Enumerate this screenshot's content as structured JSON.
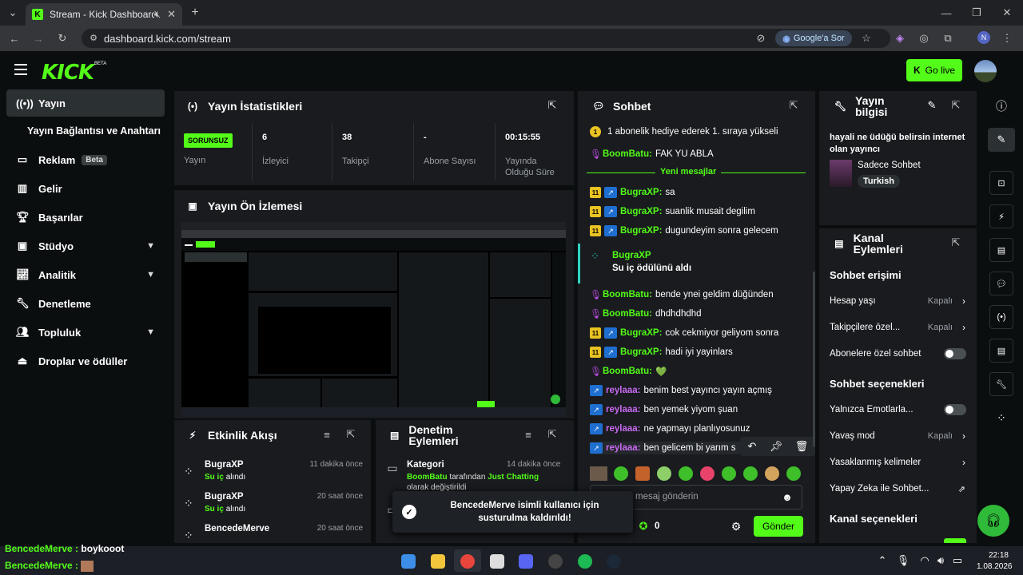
{
  "browser": {
    "tab_title": "Stream - Kick Dashboard",
    "new_tab": "+",
    "url": "dashboard.kick.com/stream",
    "google_sor": "Google'a Sor",
    "profile_initial": "N"
  },
  "header": {
    "logo": "KICK",
    "logo_beta": "BETA",
    "go_live": "Go live"
  },
  "sidebar": {
    "items": [
      {
        "label": "Yayın",
        "icon": "broadcast-icon"
      },
      {
        "label": "Yayın Bağlantısı ve Anahtarı"
      },
      {
        "label": "Reklam",
        "badge": "Beta"
      },
      {
        "label": "Gelir"
      },
      {
        "label": "Başarılar"
      },
      {
        "label": "Stüdyo"
      },
      {
        "label": "Analitik"
      },
      {
        "label": "Denetleme"
      },
      {
        "label": "Topluluk"
      },
      {
        "label": "Droplar ve ödüller"
      }
    ]
  },
  "stats": {
    "title": "Yayın İstatistikleri",
    "status": "SORUNSUZ",
    "status_label": "Yayın",
    "viewers": "6",
    "viewers_label": "İzleyici",
    "followers": "38",
    "followers_label": "Takipçi",
    "subs": "-",
    "subs_label": "Abone Sayısı",
    "uptime": "00:15:55",
    "uptime_label": "Yayında Olduğu Süre"
  },
  "preview": {
    "title": "Yayın Ön İzlemesi"
  },
  "events": {
    "title": "Etkinlik Akışı",
    "items": [
      {
        "name": "BugraXP",
        "action": "Su iç",
        "suffix": "alındı",
        "time": "11 dakika önce"
      },
      {
        "name": "BugraXP",
        "action": "Su iç",
        "suffix": "alındı",
        "time": "20 saat önce"
      },
      {
        "name": "BencedeMerve",
        "action": "",
        "suffix": "",
        "time": "20 saat önce"
      }
    ]
  },
  "moderation": {
    "title": "Denetim Eylemleri",
    "item_title": "Kategori",
    "item_time": "14 dakika önce",
    "item_user": "BoomBatu",
    "item_mid": "tarafından",
    "item_cat": "Just Chatting",
    "item_end": "olarak değiştirildi"
  },
  "toast": {
    "text": "BencedeMerve isimli kullanıcı için susturulma kaldırıldı!"
  },
  "chat": {
    "title": "Sohbet",
    "pinned": "1 abonelik hediye ederek 1. sıraya yükseli",
    "new_messages": "Yeni mesajlar",
    "messages": [
      {
        "user": "BoomBatu:",
        "text": "FAK YU ABLA"
      },
      {
        "user": "BugraXP:",
        "text": "sa"
      },
      {
        "user": "BugraXP:",
        "text": "suanlik musait degilim"
      },
      {
        "user": "BugraXP:",
        "text": "dugundeyim sonra gelecem"
      },
      {
        "user": "BugraXP",
        "text": "Su iç ödülünü aldı"
      },
      {
        "user": "BoomBatu:",
        "text": "bende ynei geldim düğünden"
      },
      {
        "user": "BoomBatu:",
        "text": "dhdhdhdhd"
      },
      {
        "user": "BugraXP:",
        "text": "cok cekmiyor geliyom sonra"
      },
      {
        "user": "BugraXP:",
        "text": "hadi iyi yayinlars"
      },
      {
        "user": "BoomBatu:",
        "text": "💚"
      },
      {
        "user": "reylaaa:",
        "text": "benim best yayıncı yayın açmış"
      },
      {
        "user": "reylaaa:",
        "text": "ben yemek yiyom şuan"
      },
      {
        "user": "reylaaa:",
        "text": "ne yapmayı planlıyosunuz"
      },
      {
        "user": "reylaaa:",
        "text": "ben gelicem bi yarım s"
      }
    ],
    "sub_badge": "11",
    "input_placeholder": "r mesaj gönderin",
    "points": "0",
    "send": "Gönder"
  },
  "stream_info": {
    "title": "Yayın bilgisi",
    "stream_title": "hayali ne üdüğü belirsin internet olan yayıncı",
    "category": "Sadece Sohbet",
    "language": "Turkish"
  },
  "channel_actions": {
    "title": "Kanal Eylemleri",
    "chat_access": "Sohbet erişimi",
    "account_age": "Hesap yaşı",
    "account_age_val": "Kapalı",
    "followers_only": "Takipçilere özel...",
    "followers_only_val": "Kapalı",
    "subs_only": "Abonelere özel sohbet",
    "chat_options": "Sohbet seçenekleri",
    "emotes_only": "Yalnızca Emotlarla...",
    "slow_mode": "Yavaş mod",
    "slow_mode_val": "Kapalı",
    "banned_words": "Yasaklanmış kelimeler",
    "ai_chat": "Yapay Zeka ile Sohbet...",
    "channel_options": "Kanal seçenekleri"
  },
  "overlay": {
    "line1_user": "BencedeMerve :",
    "line1_text": "boykooot",
    "line2_user": "BencedeMerve :"
  },
  "taskbar": {
    "time": "22:18",
    "date": "1.08.2026"
  },
  "colors": {
    "kick_green": "#53fc18",
    "panel": "#191b1f",
    "bg": "#0b0e0f",
    "sub_gold": "#e9c322",
    "badge_blue": "#1f6fd0"
  }
}
